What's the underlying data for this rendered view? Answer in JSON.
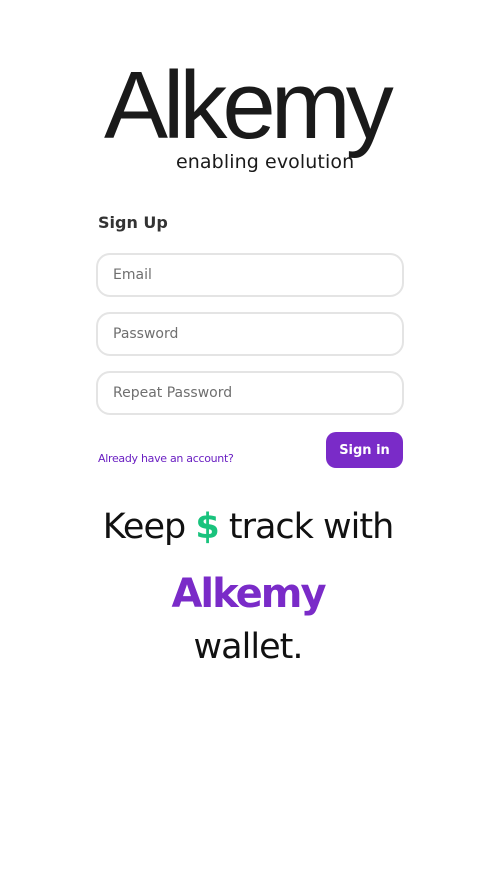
{
  "logo": {
    "word": "Alkemy",
    "tagline": "enabling evolution"
  },
  "form": {
    "title": "Sign Up",
    "email_placeholder": "Email",
    "password_placeholder": "Password",
    "repeat_password_placeholder": "Repeat Password",
    "account_link": "Already have an account?",
    "signin_label": "Sign in"
  },
  "headline": {
    "keep": "Keep",
    "dollar_icon": "$",
    "track_with": "track with",
    "brand": "Alkemy",
    "wallet": "wallet."
  },
  "colors": {
    "accent": "#7a2bc8",
    "dollar": "#19c37d",
    "text": "#111111"
  }
}
